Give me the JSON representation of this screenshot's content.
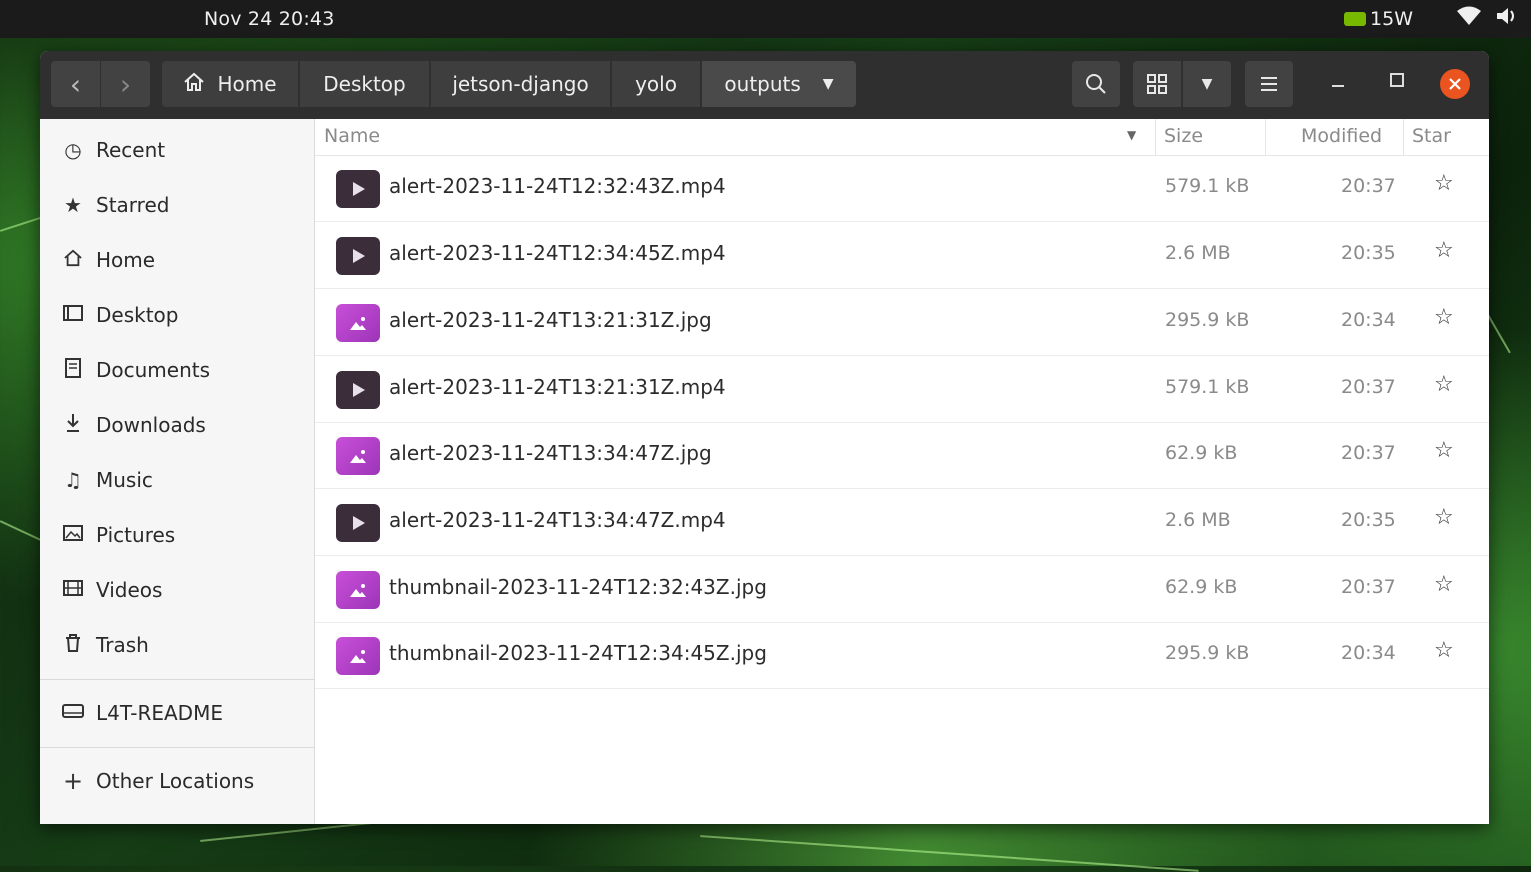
{
  "topbar": {
    "clock": "Nov 24  20:43",
    "power": "15W",
    "icons": [
      "nvidia-icon",
      "wifi-icon",
      "volume-icon"
    ]
  },
  "header": {
    "back_icon": "‹",
    "forward_icon": "›",
    "breadcrumbs": [
      "Home",
      "Desktop",
      "jetson-django",
      "yolo",
      "outputs"
    ],
    "search_icon": "search-icon",
    "view_icon": "grid-view-icon",
    "menu_icon": "hamburger-menu-icon"
  },
  "sidebar": {
    "items": [
      {
        "label": "Recent",
        "icon": "clock-icon"
      },
      {
        "label": "Starred",
        "icon": "star-icon"
      },
      {
        "label": "Home",
        "icon": "home-icon"
      },
      {
        "label": "Desktop",
        "icon": "desktop-icon"
      },
      {
        "label": "Documents",
        "icon": "document-icon"
      },
      {
        "label": "Downloads",
        "icon": "download-icon"
      },
      {
        "label": "Music",
        "icon": "music-icon"
      },
      {
        "label": "Pictures",
        "icon": "picture-icon"
      },
      {
        "label": "Videos",
        "icon": "video-icon"
      },
      {
        "label": "Trash",
        "icon": "trash-icon"
      }
    ],
    "device": {
      "label": "L4T-README",
      "icon": "drive-icon"
    },
    "other": {
      "label": "Other Locations",
      "icon": "plus-icon"
    }
  },
  "columns": {
    "name": "Name",
    "size": "Size",
    "modified": "Modified",
    "star": "Star"
  },
  "files": [
    {
      "name": "alert-2023-11-24T12:32:43Z.mp4",
      "type": "video",
      "size": "579.1 kB",
      "modified": "20:37"
    },
    {
      "name": "alert-2023-11-24T12:34:45Z.mp4",
      "type": "video",
      "size": "2.6 MB",
      "modified": "20:35"
    },
    {
      "name": "alert-2023-11-24T13:21:31Z.jpg",
      "type": "image",
      "size": "295.9 kB",
      "modified": "20:34"
    },
    {
      "name": "alert-2023-11-24T13:21:31Z.mp4",
      "type": "video",
      "size": "579.1 kB",
      "modified": "20:37"
    },
    {
      "name": "alert-2023-11-24T13:34:47Z.jpg",
      "type": "image",
      "size": "62.9 kB",
      "modified": "20:37"
    },
    {
      "name": "alert-2023-11-24T13:34:47Z.mp4",
      "type": "video",
      "size": "2.6 MB",
      "modified": "20:35"
    },
    {
      "name": "thumbnail-2023-11-24T12:32:43Z.jpg",
      "type": "image",
      "size": "62.9 kB",
      "modified": "20:37"
    },
    {
      "name": "thumbnail-2023-11-24T12:34:45Z.jpg",
      "type": "image",
      "size": "295.9 kB",
      "modified": "20:34"
    }
  ],
  "colors": {
    "close_button": "#e95420",
    "image_icon": "#c94fd9",
    "video_icon": "#3b2d3a"
  }
}
